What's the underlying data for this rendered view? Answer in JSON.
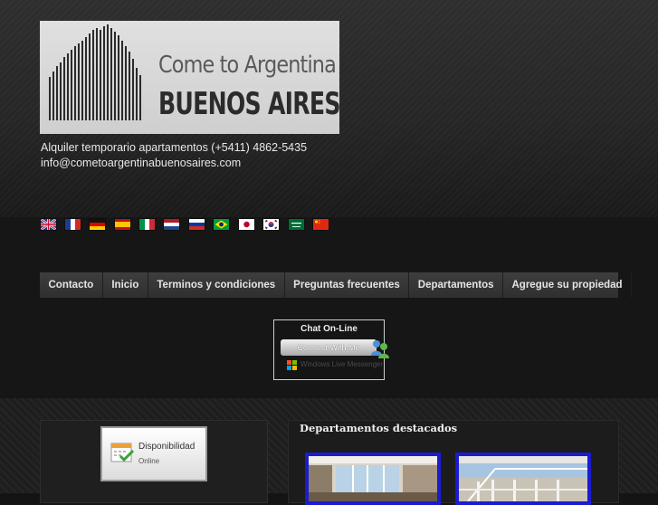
{
  "header": {
    "logo_line1": "Come to Argentina",
    "logo_line2": "BUENOS AIRES",
    "tagline": "Alquiler temporario apartamentos (+5411) 4862-5435",
    "email": "info@cometoargentinabuenosaires.com"
  },
  "languages": [
    "English",
    "Français",
    "Deutsch",
    "Español",
    "Italiano",
    "Nederlands",
    "Русский",
    "Português",
    "日本語",
    "한국어",
    "العربية",
    "中文"
  ],
  "nav": {
    "items": [
      "Contacto",
      "Inicio",
      "Terminos y condiciones",
      "Preguntas frecuentes",
      "Departamentos",
      "Agregue su propiedad"
    ]
  },
  "chat": {
    "title": "Chat On-Line",
    "button": "Connect With Me",
    "powered": "Windows Live Messenger"
  },
  "availability": {
    "title": "Disponibilidad",
    "subtitle": "Online"
  },
  "featured": {
    "title": "Departamentos destacados"
  },
  "colors": {
    "thumb_border": "#1b1bd0",
    "nav_bg": "#353535"
  }
}
